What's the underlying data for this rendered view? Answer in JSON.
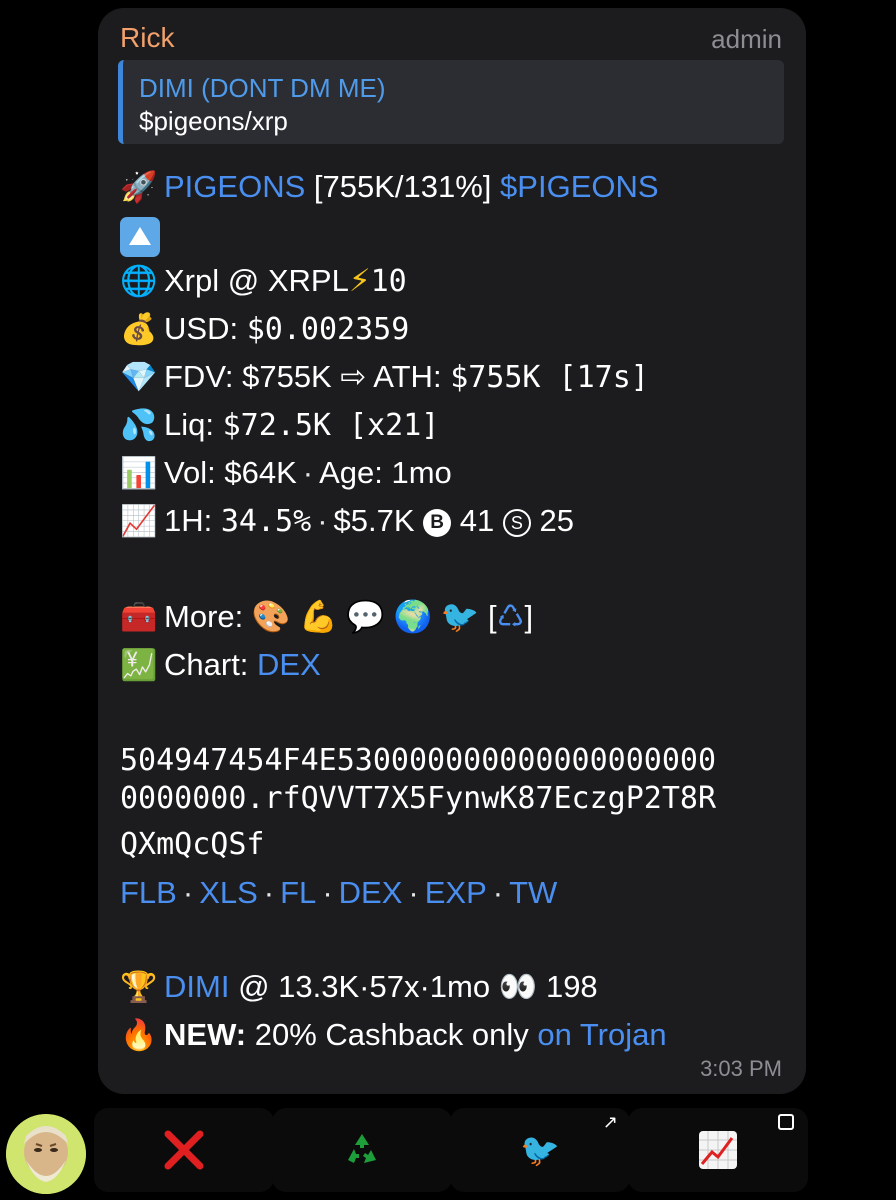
{
  "message": {
    "sender": "Rick",
    "role": "admin",
    "reply": {
      "name": "DIMI (DONT DM ME)",
      "text": "$pigeons/xrp"
    },
    "title_line": {
      "name": "PIGEONS",
      "stats": "[755K/131%]",
      "ticker": "$PIGEONS"
    },
    "chain_line": {
      "text": "Xrpl @ XRPL",
      "bolt_count": "10"
    },
    "usd_line": {
      "label": "USD:",
      "value": "$0.002359"
    },
    "fdv_line": {
      "label": "FDV:",
      "value": "$755K",
      "arrow": "⇨",
      "ath_label": "ATH:",
      "ath_value": "$755K [17s]"
    },
    "liq_line": {
      "label": "Liq:",
      "value": "$72.5K [x21]"
    },
    "vol_line": {
      "label": "Vol:",
      "value": "$64K",
      "sep": "·",
      "age_label": "Age:",
      "age_value": "1mo"
    },
    "h1_line": {
      "label": "1H:",
      "pct": "34.5%",
      "sep": "·",
      "usd": "$5.7K",
      "buys": "41",
      "sells": "25"
    },
    "more_line": {
      "label": "More:",
      "bracket_open": "[",
      "bracket_close": "]"
    },
    "chart_line": {
      "label": "Chart:",
      "link": "DEX"
    },
    "address_lines": [
      "504947454F4E530000000000000000000",
      "0000000.rfQVVT7X5FynwK87EczgP2T8R",
      "QXmQcQSf"
    ],
    "links": [
      "FLB",
      "XLS",
      "FL",
      "DEX",
      "EXP",
      "TW"
    ],
    "links_sep": "·",
    "trophy_line": {
      "link": "DIMI",
      "text": "@ 13.3K·57x·1mo",
      "count": "198"
    },
    "new_line": {
      "bold": "NEW:",
      "text": "20% Cashback only",
      "link": "on Trojan"
    },
    "time": "3:03 PM"
  },
  "icons": {
    "rocket": "rocket-icon",
    "up_arrow": "up-arrow-button-icon",
    "globe": "globe-icon",
    "bolt": "lightning-icon",
    "money_bag": "money-bag-icon",
    "gem": "gem-icon",
    "droplets": "sweat-droplets-icon",
    "bar_chart": "bar-chart-icon",
    "chart_up": "chart-increasing-icon",
    "toolbox": "toolbox-icon",
    "chart_yen": "chart-with-upwards-trend-and-yen-icon",
    "trophy": "trophy-icon",
    "fire": "fire-icon",
    "eyes": "eyes-icon",
    "recycle": "recycle-icon",
    "bird": "bird-icon"
  },
  "colors": {
    "background": "#000000",
    "bubble": "#1c1c1e",
    "sender": "#f2a06c",
    "link": "#4a8ff0",
    "reply_bar": "#3d86d9",
    "muted": "#8d8d93",
    "red_x": "#e02020",
    "recycle_green": "#1e9e3a"
  }
}
